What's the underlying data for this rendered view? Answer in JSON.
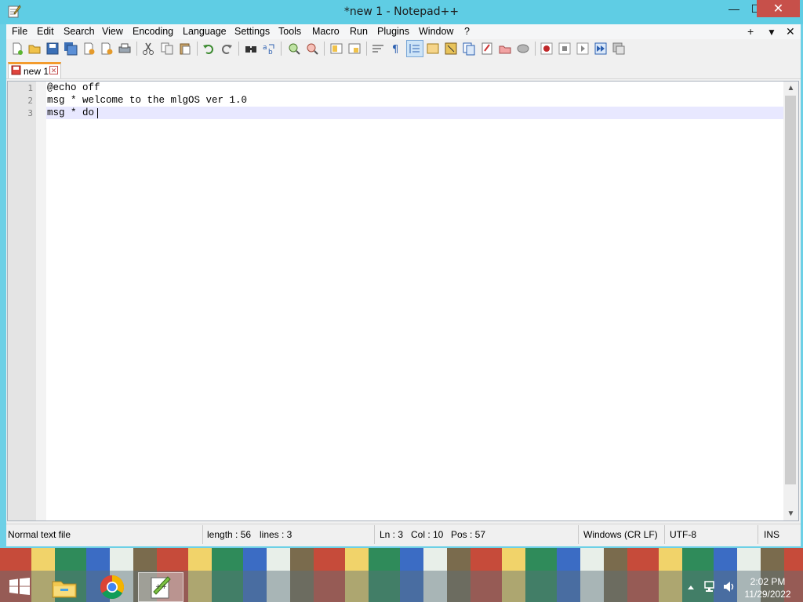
{
  "window": {
    "title": "*new 1 - Notepad++",
    "min_label": "—",
    "max_label": "☐",
    "close_label": "✕"
  },
  "menu": {
    "items": [
      "File",
      "Edit",
      "Search",
      "View",
      "Encoding",
      "Language",
      "Settings",
      "Tools",
      "Macro",
      "Run",
      "Plugins",
      "Window",
      "?"
    ],
    "right": [
      "+",
      "▼",
      "✕"
    ]
  },
  "tabs": [
    {
      "label": "new 1",
      "close": "✕"
    }
  ],
  "editor": {
    "lines": [
      {
        "num": "1",
        "text": "@echo off"
      },
      {
        "num": "2",
        "text": "msg * welcome to the mlgOS ver 1.0"
      },
      {
        "num": "3",
        "text": "msg * do"
      }
    ],
    "current_line": 3
  },
  "statusbar": {
    "file_type": "Normal text file",
    "length": "length : 56",
    "lines": "lines : 3",
    "ln": "Ln : 3",
    "col": "Col : 10",
    "pos": "Pos : 57",
    "eol": "Windows (CR LF)",
    "encoding": "UTF-8",
    "mode": "INS"
  },
  "taskbar": {
    "time": "2:02 PM",
    "date": "11/29/2022",
    "apps": [
      "file-explorer",
      "chrome",
      "notepad-plus-plus"
    ]
  },
  "colors": {
    "accent": "#5fcde4",
    "close": "#c7504a",
    "tab_accent": "#f39b2d",
    "current_line": "#e8e8ff"
  }
}
